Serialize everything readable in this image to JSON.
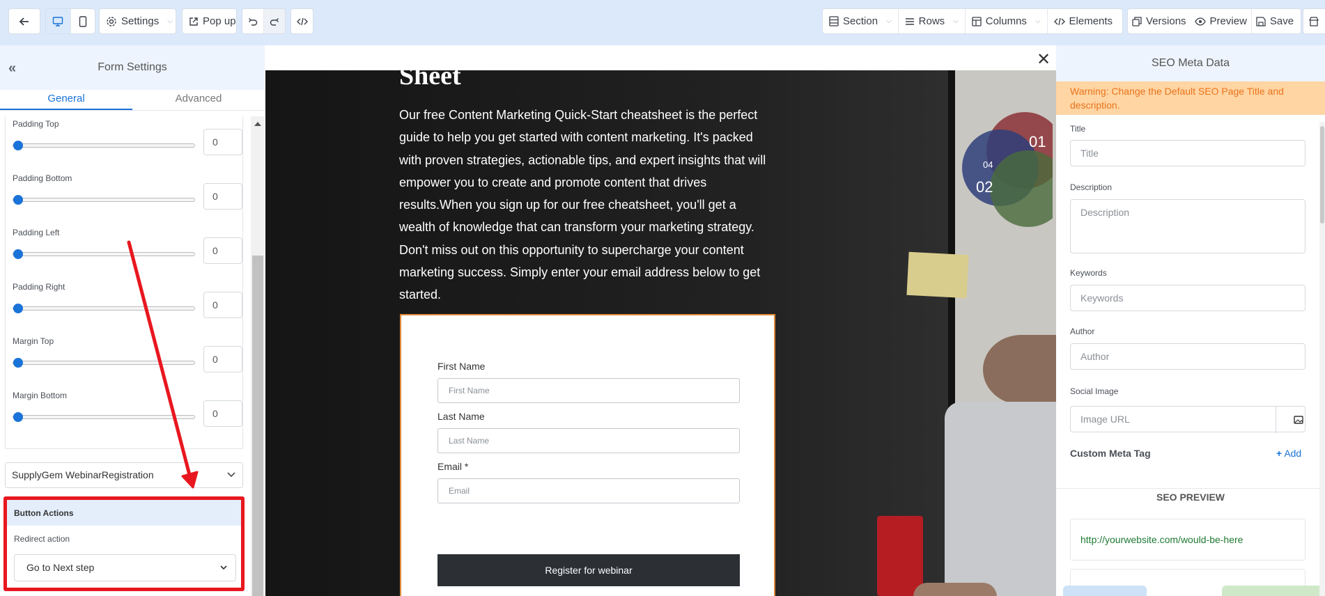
{
  "toolbar": {
    "back_label": "",
    "settings_label": "Settings",
    "popup_label": "Pop up",
    "section_label": "Section",
    "rows_label": "Rows",
    "columns_label": "Columns",
    "elements_label": "Elements",
    "versions_label": "Versions",
    "preview_label": "Preview",
    "save_label": "Save"
  },
  "left_panel": {
    "title": "Form Settings",
    "tabs": [
      {
        "label": "General",
        "active": true
      },
      {
        "label": "Advanced",
        "active": false
      }
    ],
    "fields": [
      {
        "label": "Padding Top",
        "value": "0"
      },
      {
        "label": "Padding Bottom",
        "value": "0"
      },
      {
        "label": "Padding Left",
        "value": "0"
      },
      {
        "label": "Padding Right",
        "value": "0"
      },
      {
        "label": "Margin Top",
        "value": "0"
      },
      {
        "label": "Margin Bottom",
        "value": "0"
      }
    ],
    "form_select": "SupplyGem WebinarRegistration",
    "button_actions": {
      "title": "Button Actions",
      "redirect_label": "Redirect action",
      "redirect_value": "Go to Next step"
    }
  },
  "canvas": {
    "headline": "Sheet",
    "paragraph": "Our free Content Marketing Quick-Start cheatsheet is the perfect guide to help you get started with content marketing. It's packed with proven strategies, actionable tips, and expert insights that will empower you to create and promote content that drives results.When you sign up for our free cheatsheet, you'll get a wealth of knowledge that can transform your marketing strategy. Don't miss out on this opportunity to supercharge your content marketing success. Simply enter your email address below to get started.",
    "venn_labels": [
      "01",
      "04",
      "02"
    ],
    "form": {
      "first_name_label": "First Name",
      "first_name_placeholder": "First Name",
      "last_name_label": "Last Name",
      "last_name_placeholder": "Last Name",
      "email_label": "Email *",
      "email_placeholder": "Email",
      "submit_label": "Register for webinar"
    }
  },
  "right_panel": {
    "title": "SEO Meta Data",
    "warning": "Warning: Change the Default SEO Page Title and description.",
    "title_label": "Title",
    "title_placeholder": "Title",
    "description_label": "Description",
    "description_placeholder": "Description",
    "keywords_label": "Keywords",
    "keywords_placeholder": "Keywords",
    "author_label": "Author",
    "author_placeholder": "Author",
    "social_image_label": "Social Image",
    "image_url_placeholder": "Image URL",
    "custom_meta_label": "Custom Meta Tag",
    "add_label": "Add",
    "seo_preview_label": "SEO PREVIEW",
    "preview_url": "http://yourwebsite.com/would-be-here"
  },
  "colors": {
    "accent": "#1a73d8",
    "annotation_red": "#e8171f",
    "warning_bg": "#ffd5a3",
    "warning_text": "#e8741c",
    "form_border": "#e08a3a",
    "submit_bg": "#2c3035"
  }
}
